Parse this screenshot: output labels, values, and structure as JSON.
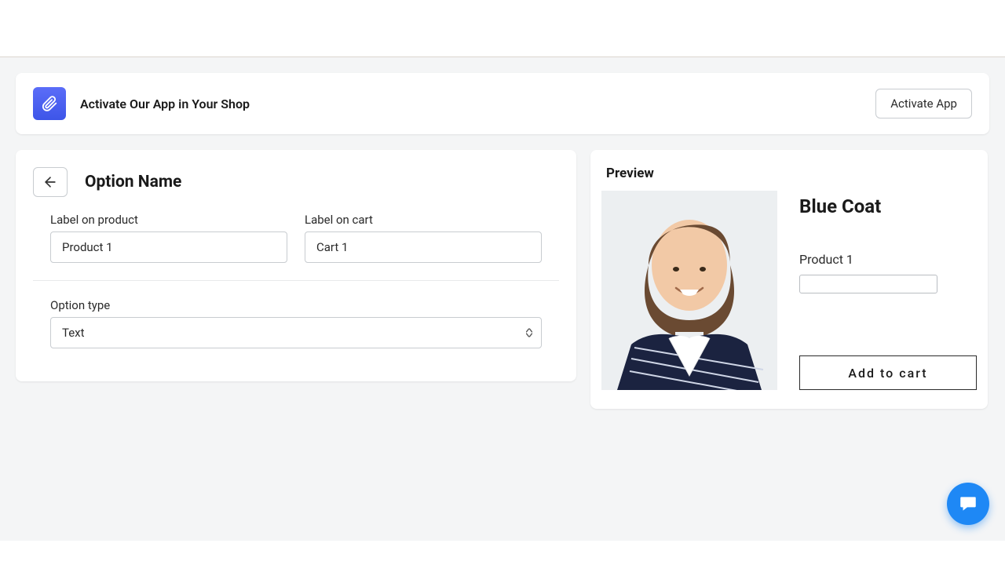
{
  "banner": {
    "title": "Activate Our App in Your Shop",
    "activate_label": "Activate App"
  },
  "form": {
    "heading": "Option Name",
    "label_on_product_title": "Label on product",
    "label_on_product_value": "Product 1",
    "label_on_cart_title": "Label on cart",
    "label_on_cart_value": "Cart 1",
    "option_type_title": "Option type",
    "option_type_value": "Text"
  },
  "preview": {
    "title": "Preview",
    "product_name": "Blue Coat",
    "field_label": "Product 1",
    "add_to_cart_label": "Add to cart"
  }
}
